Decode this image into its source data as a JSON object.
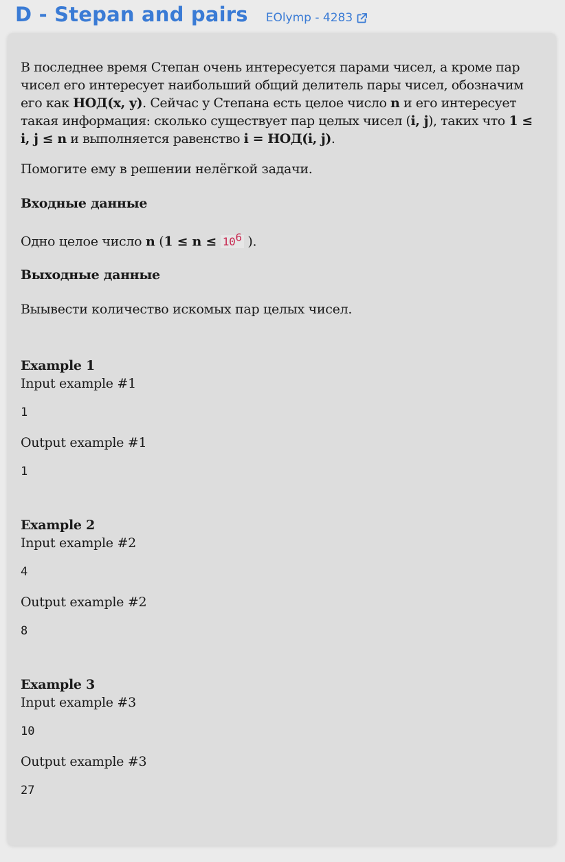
{
  "header": {
    "title": "D - Stepan and pairs",
    "source_link": "EOlymp - 4283",
    "link_color": "#3a7bd5"
  },
  "statement": {
    "p1_a": "В последнее время Степан очень интересуется парами чисел, а кроме пар чисел его интересует наибольший общий делитель пары чисел, обозначим его как ",
    "p1_gcd_xy": "НОД(x, y)",
    "p1_b": ". Сейчас у Степана есть целое число ",
    "p1_n": "n",
    "p1_c": " и его интересует такая информация: сколько существует пар целых чисел (",
    "p1_ij": "i, j",
    "p1_d": "), таких что ",
    "p1_cond": "1 ≤ i, j ≤ n",
    "p1_e": " и выполняется равенство ",
    "p1_eq": "i = НОД(i, j)",
    "p1_f": ".",
    "p2": "Помогите ему в решении нелёгкой задачи."
  },
  "input_section": {
    "heading": "Входные данные",
    "text_a": "Одно целое число ",
    "n": "n",
    "text_b": " (",
    "cond": "1 ≤ n ≤",
    "code_base": "10",
    "code_exp": "6",
    "text_c": " )."
  },
  "output_section": {
    "heading": "Выходные данные",
    "text": "Выывести количество искомых пар целых чисел."
  },
  "examples": [
    {
      "title": "Example 1",
      "input_label": "Input example #1",
      "input": "1",
      "output_label": "Output example #1",
      "output": "1"
    },
    {
      "title": "Example 2",
      "input_label": "Input example #2",
      "input": "4",
      "output_label": "Output example #2",
      "output": "8"
    },
    {
      "title": "Example 3",
      "input_label": "Input example #3",
      "input": "10",
      "output_label": "Output example #3",
      "output": "27"
    }
  ]
}
